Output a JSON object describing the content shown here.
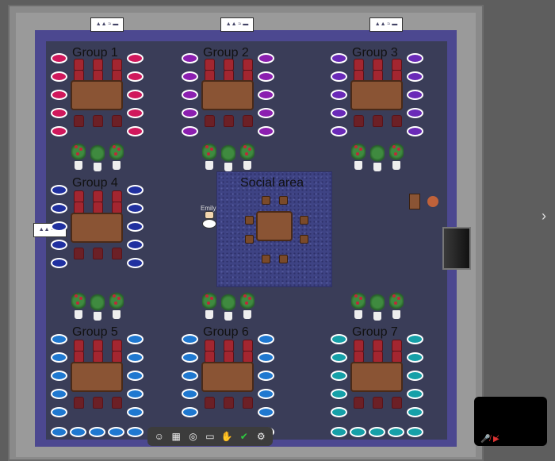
{
  "groups": [
    {
      "id": "g1",
      "label": "Group 1",
      "color": "#d0185c"
    },
    {
      "id": "g2",
      "label": "Group 2",
      "color": "#8b1fb0"
    },
    {
      "id": "g3",
      "label": "Group 3",
      "color": "#6a2ab8"
    },
    {
      "id": "g4",
      "label": "Group 4",
      "color": "#2030a0"
    },
    {
      "id": "g5",
      "label": "Group 5",
      "color": "#1f78d0"
    },
    {
      "id": "g6",
      "label": "Group 6",
      "color": "#1f78d0"
    },
    {
      "id": "g7",
      "label": "Group 7",
      "color": "#16a0a8"
    }
  ],
  "social_area": {
    "label": "Social area"
  },
  "avatar": {
    "name": "Emily"
  },
  "toolbar": {
    "items": [
      {
        "name": "avatar-icon",
        "glyph": "☺"
      },
      {
        "name": "map-icon",
        "glyph": "▦"
      },
      {
        "name": "target-icon",
        "glyph": "◎"
      },
      {
        "name": "screen-share-icon",
        "glyph": "▭"
      },
      {
        "name": "hand-icon",
        "glyph": "✋"
      },
      {
        "name": "status-check-icon",
        "glyph": "✔"
      },
      {
        "name": "gear-icon",
        "glyph": "⚙"
      }
    ]
  },
  "video": {
    "mic_icon": "mic-muted-icon",
    "camera_icon": "camera-off-icon"
  },
  "colors": {
    "floor": "#3a3d58",
    "carpet_border": "#4c4890",
    "wall": "#9a9a9a"
  }
}
